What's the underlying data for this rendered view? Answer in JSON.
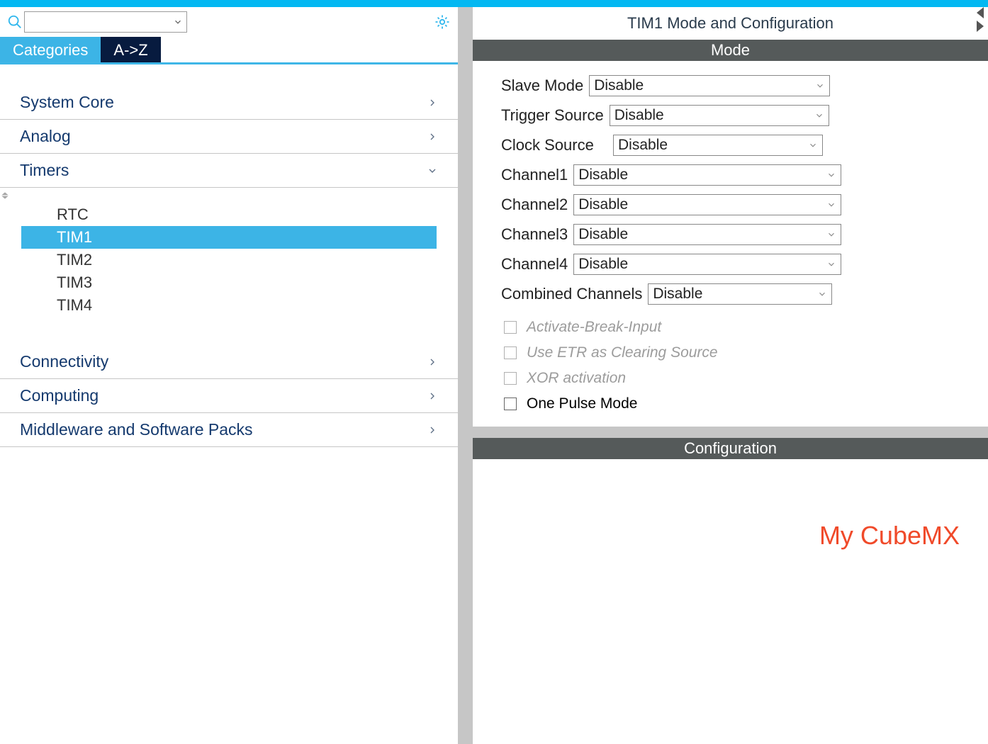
{
  "left": {
    "tabs": {
      "categories": "Categories",
      "az": "A->Z"
    },
    "groups": {
      "system_core": "System Core",
      "analog": "Analog",
      "timers": "Timers",
      "connectivity": "Connectivity",
      "computing": "Computing",
      "middleware": "Middleware and Software Packs"
    },
    "timers_items": {
      "rtc": "RTC",
      "tim1": "TIM1",
      "tim2": "TIM2",
      "tim3": "TIM3",
      "tim4": "TIM4"
    }
  },
  "right": {
    "title": "TIM1 Mode and Configuration",
    "mode_header": "Mode",
    "config_header": "Configuration",
    "labels": {
      "slave_mode": "Slave Mode",
      "trigger_source": "Trigger Source",
      "clock_source": "Clock Source",
      "channel1": "Channel1",
      "channel2": "Channel2",
      "channel3": "Channel3",
      "channel4": "Channel4",
      "combined_channels": "Combined Channels",
      "activate_break": "Activate-Break-Input",
      "use_etr": "Use ETR as Clearing Source",
      "xor": "XOR activation",
      "one_pulse": "One Pulse Mode"
    },
    "values": {
      "slave_mode": "Disable",
      "trigger_source": "Disable",
      "clock_source": "Disable",
      "channel1": "Disable",
      "channel2": "Disable",
      "channel3": "Disable",
      "channel4": "Disable",
      "combined_channels": "Disable"
    },
    "watermark": "My CubeMX"
  }
}
